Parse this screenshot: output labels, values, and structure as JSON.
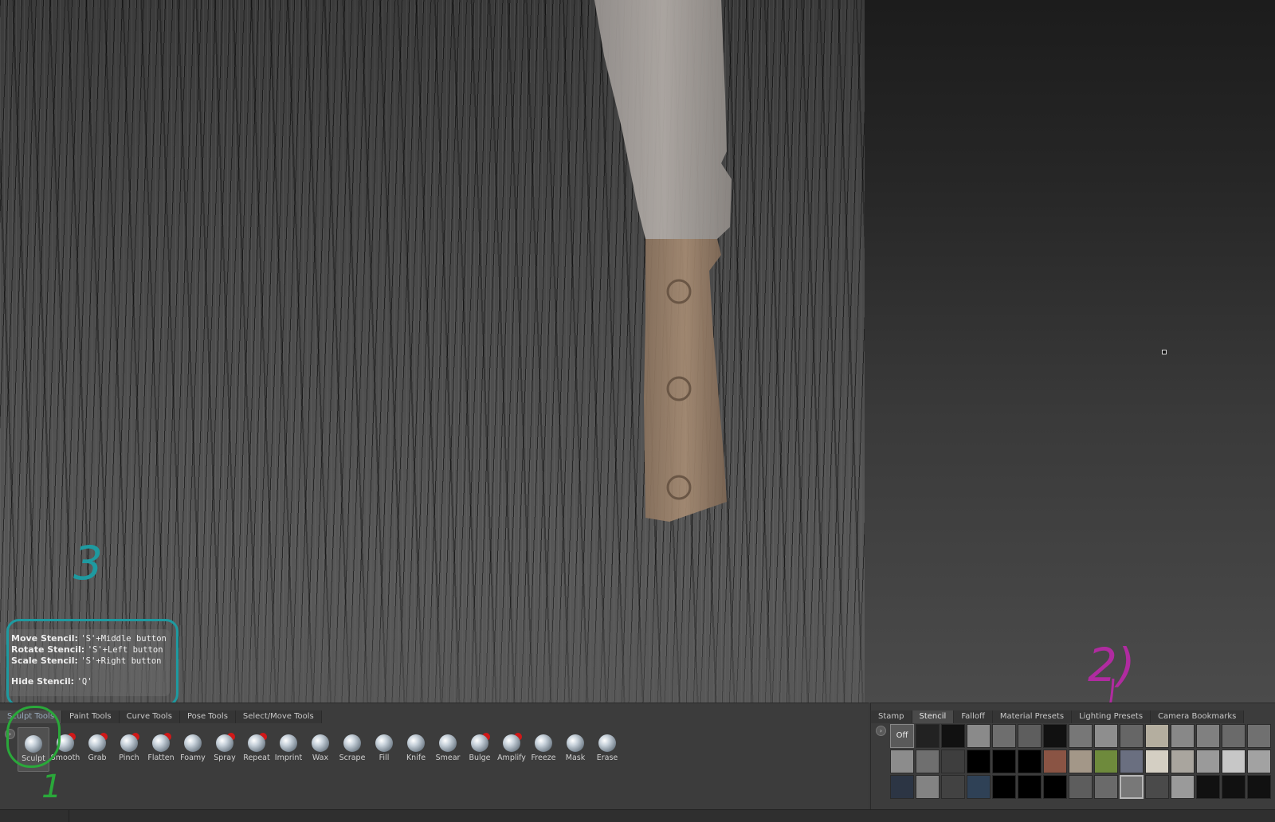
{
  "hints": {
    "move_label": "Move Stencil:",
    "move_key": "'S'+Middle button",
    "rotate_label": "Rotate Stencil:",
    "rotate_key": "'S'+Left button",
    "scale_label": "Scale Stencil:",
    "scale_key": "'S'+Right button",
    "hide_label": "Hide Stencil:",
    "hide_key": "'Q'"
  },
  "annotations": {
    "one": "1",
    "two": "2)",
    "three": "3"
  },
  "tool_tabs": [
    "Sculpt Tools",
    "Paint Tools",
    "Curve Tools",
    "Pose Tools",
    "Select/Move Tools"
  ],
  "tools": [
    "Sculpt",
    "Smooth",
    "Grab",
    "Pinch",
    "Flatten",
    "Foamy",
    "Spray",
    "Repeat",
    "Imprint",
    "Wax",
    "Scrape",
    "Fill",
    "Knife",
    "Smear",
    "Bulge",
    "Amplify",
    "Freeze",
    "Mask",
    "Erase"
  ],
  "preset_tabs": [
    "Stamp",
    "Stencil",
    "Falloff",
    "Material Presets",
    "Lighting Presets",
    "Camera Bookmarks"
  ],
  "stencils": {
    "off_label": "Off"
  },
  "colors": {
    "annotation_teal": "#1e9aa0",
    "annotation_green": "#2aa83a",
    "annotation_pink": "#b02ba0"
  }
}
